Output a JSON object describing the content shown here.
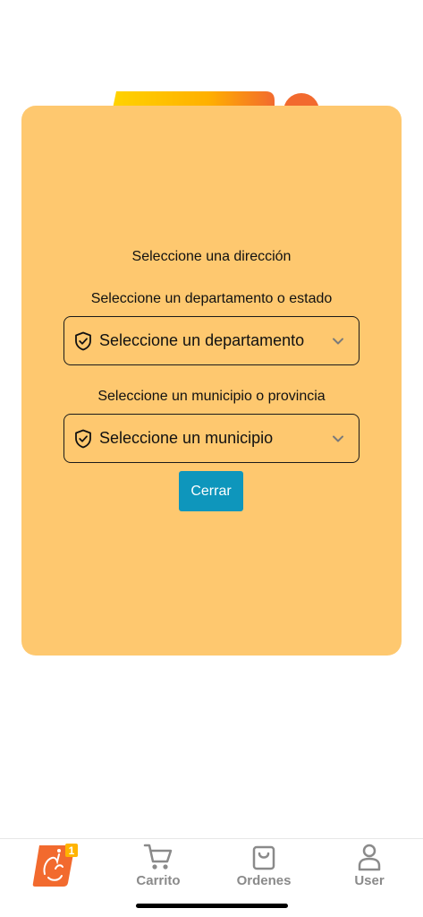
{
  "modal": {
    "title": "Seleccione una dirección",
    "department": {
      "label": "Seleccione un departamento o estado",
      "selected": "Seleccione un departamento"
    },
    "municipality": {
      "label": "Seleccione un municipio o provincia",
      "selected": "Seleccione un municipio"
    },
    "close_label": "Cerrar"
  },
  "tabbar": {
    "home_badge": "1",
    "items": [
      {
        "label": "Carrito",
        "icon": "cart-icon"
      },
      {
        "label": "Ordenes",
        "icon": "bag-icon"
      },
      {
        "label": "User",
        "icon": "user-icon"
      }
    ]
  },
  "colors": {
    "modal_bg": "#fec86f",
    "button_bg": "#0e96bc",
    "brand_orange": "#f26a2e",
    "tab_inactive": "#8a8a8a"
  }
}
